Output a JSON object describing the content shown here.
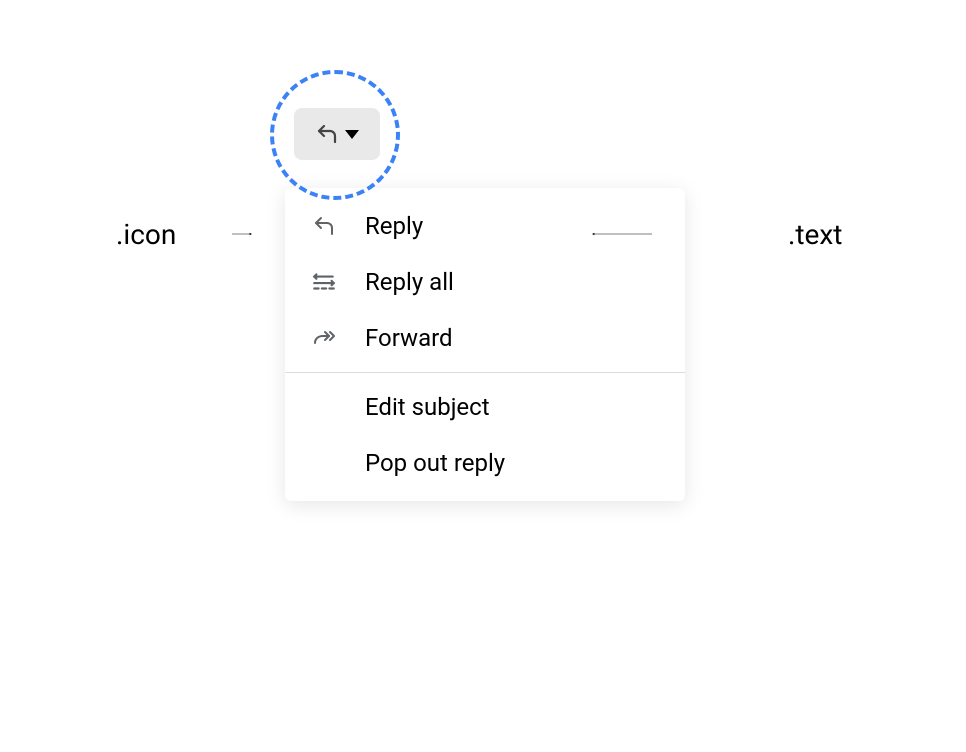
{
  "annotations": {
    "icon_label": ".icon",
    "text_label": ".text"
  },
  "menu": {
    "items": [
      {
        "label": "Reply",
        "icon_name": "reply-icon"
      },
      {
        "label": "Reply all",
        "icon_name": "reply-all-icon"
      },
      {
        "label": "Forward",
        "icon_name": "forward-icon"
      },
      {
        "label": "Edit subject"
      },
      {
        "label": "Pop out reply"
      }
    ]
  }
}
